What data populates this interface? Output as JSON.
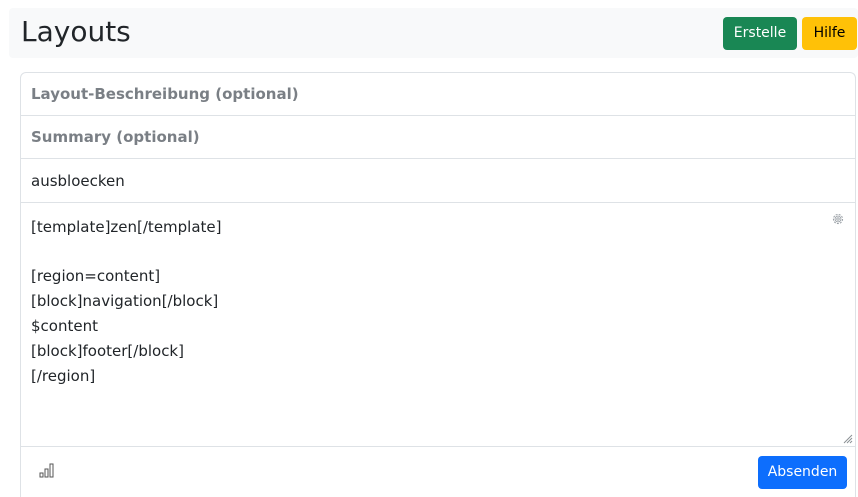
{
  "header": {
    "title": "Layouts",
    "create_label": "Erstelle",
    "help_label": "Hilfe"
  },
  "form": {
    "description_placeholder": "Layout-Beschreibung (optional)",
    "summary_placeholder": "Summary (optional)",
    "name_value": "ausbloecken",
    "editor_lines": [
      "[template]zen[/template]",
      "",
      "[region=content]",
      "[block]navigation[/block]",
      "$content",
      "[block]footer[/block]",
      "[/region]"
    ],
    "submit_label": "Absenden"
  },
  "icons": {
    "editor_settings": "gear-icon",
    "resize": "resize-grip-icon",
    "stats": "bar-chart-icon"
  },
  "colors": {
    "create_button": "#198754",
    "help_button": "#ffc107",
    "submit_button": "#0d6efd",
    "header_background": "#f8f9fa"
  }
}
